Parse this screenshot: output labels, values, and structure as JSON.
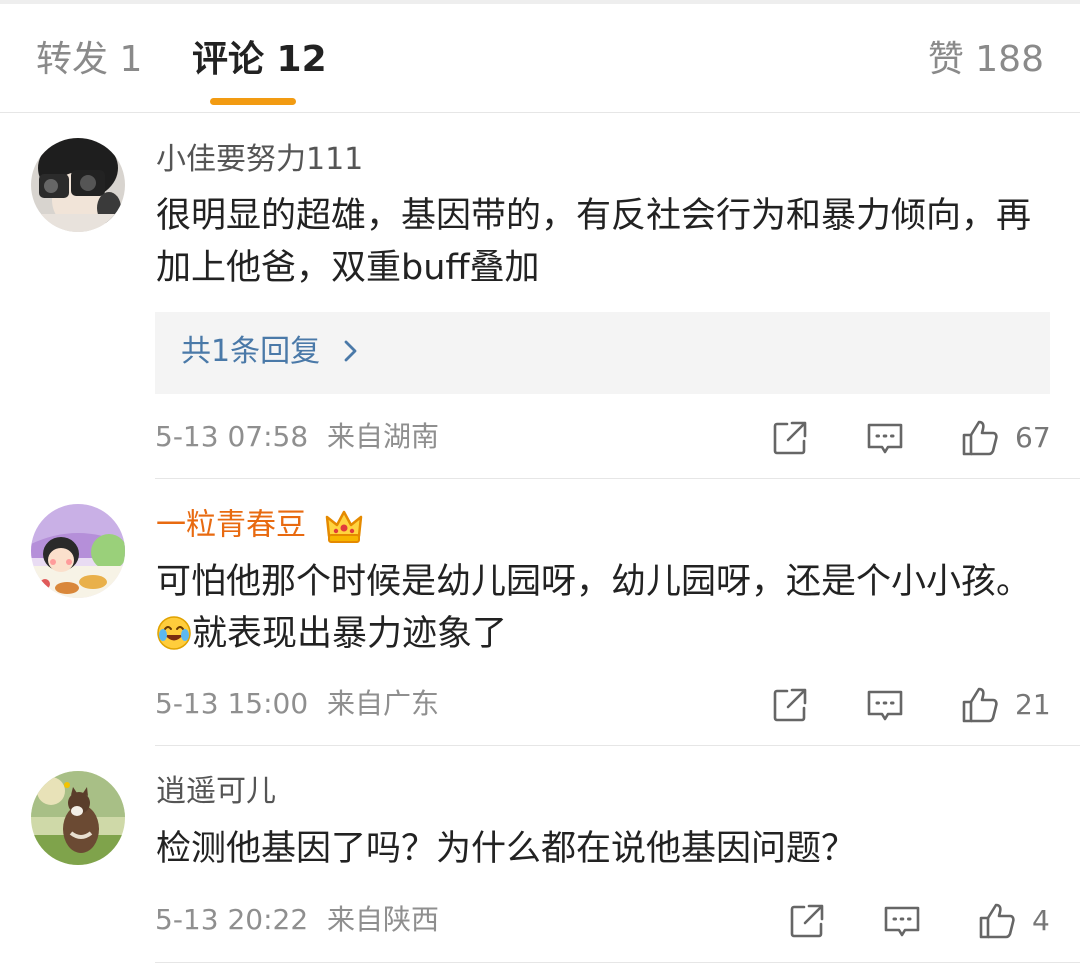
{
  "tabs": {
    "repost": "转发 1",
    "comment": "评论 12",
    "likes": "赞 188"
  },
  "accent_color": "#f29b12",
  "comments": [
    {
      "username": "小佳要努力111",
      "text": "很明显的超雄，基因带的，有反社会行为和暴力倾向，再加上他爸，双重buff叠加",
      "reply_summary": "共1条回复",
      "time": "5-13 07:58",
      "location": "来自湖南",
      "likes": "67",
      "icons": [
        "share-icon",
        "comment-icon",
        "like-icon"
      ]
    },
    {
      "username": "一粒青春豆",
      "badge": "crown-icon",
      "text_before_emoji": "可怕他那个时候是幼儿园呀，幼儿园呀，还是个小小孩。",
      "emoji": "laugh-cry-emoji",
      "text_after_emoji": "就表现出暴力迹象了",
      "time": "5-13 15:00",
      "location": "来自广东",
      "likes": "21"
    },
    {
      "username": "逍遥可儿",
      "text": "检测他基因了吗？为什么都在说他基因问题？",
      "time": "5-13 20:22",
      "location": "来自陕西",
      "likes": "4"
    }
  ]
}
